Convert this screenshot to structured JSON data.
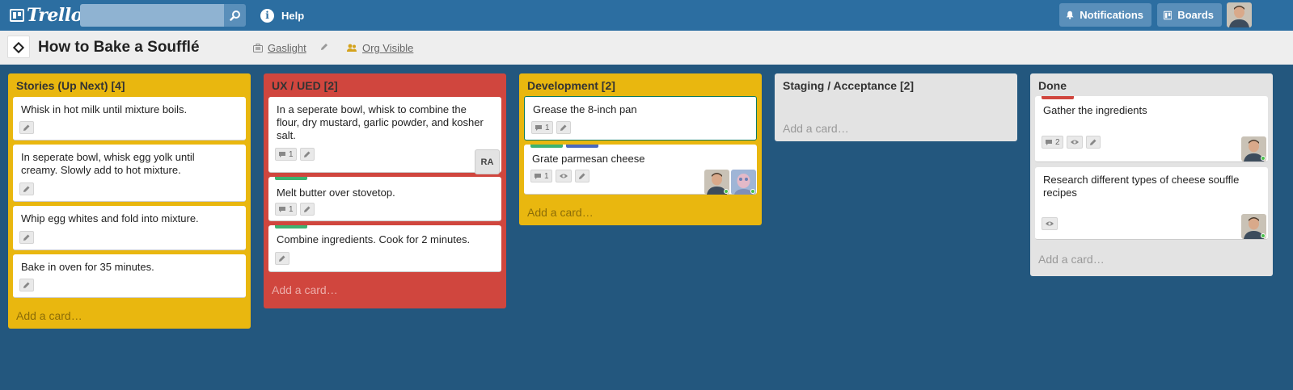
{
  "header": {
    "logo_text": "Trello",
    "search_value": "",
    "help_label": "Help",
    "notifications_label": "Notifications",
    "boards_label": "Boards"
  },
  "board": {
    "title": "How to Bake a Soufflé",
    "org_name": "Gaslight",
    "visibility": "Org Visible"
  },
  "lists": [
    {
      "title": "Stories (Up Next) [4]",
      "add_card": "Add a card…",
      "cards": [
        {
          "text": "Whisk in hot milk until mixture boils."
        },
        {
          "text": "In seperate bowl, whisk egg yolk until creamy. Slowly add to hot mixture."
        },
        {
          "text": "Whip egg whites and fold into mixture."
        },
        {
          "text": "Bake in oven for 35 minutes."
        }
      ]
    },
    {
      "title": "UX / UED [2]",
      "add_card": "Add a card…",
      "cards": [
        {
          "text": "In a seperate bowl, whisk to combine the flour, dry mustard, garlic powder, and kosher salt.",
          "comments": "1",
          "member_initials": "RA"
        },
        {
          "text": "Melt butter over stovetop.",
          "comments": "1"
        },
        {
          "text": "Combine ingredients. Cook for 2 minutes."
        }
      ]
    },
    {
      "title": "Development [2]",
      "add_card": "Add a card…",
      "cards": [
        {
          "text": "Grease the 8-inch pan",
          "comments": "1"
        },
        {
          "text": "Grate parmesan cheese",
          "comments": "1"
        }
      ]
    },
    {
      "title": "Staging / Acceptance [2]",
      "add_card": "Add a card…",
      "cards": []
    },
    {
      "title": "Done",
      "add_card": "Add a card…",
      "cards": [
        {
          "text": "Gather the ingredients",
          "comments": "2"
        },
        {
          "text": "Research different types of cheese souffle recipes"
        }
      ]
    }
  ],
  "colors": {
    "board_bg": "#23577e",
    "header_bg": "#2c6ea1",
    "list_yellow": "#e9b70f",
    "list_red": "#d0463e",
    "list_grey": "#e3e3e3",
    "label_green": "#3cb371",
    "label_blue": "#4a69bd",
    "label_red": "#d0463e"
  }
}
